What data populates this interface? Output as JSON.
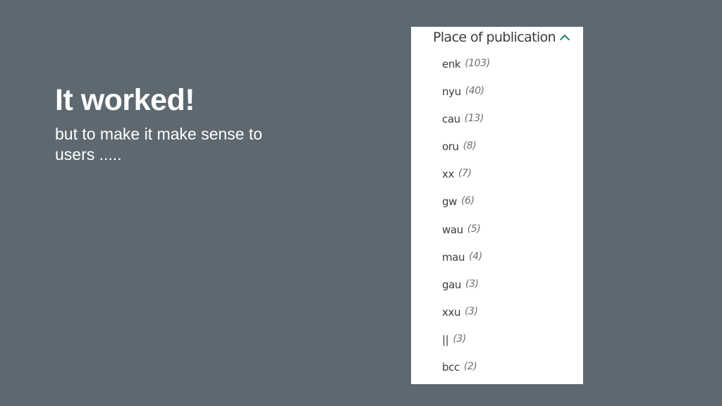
{
  "slide": {
    "title": "It worked!",
    "subtitle": "but to make it make sense to users ....."
  },
  "facet": {
    "header": "Place of publication",
    "icon": "chevron-up-icon",
    "accent_color": "#1f7a74",
    "items": [
      {
        "label": "enk",
        "count": "(103)"
      },
      {
        "label": "nyu",
        "count": "(40)"
      },
      {
        "label": "cau",
        "count": "(13)"
      },
      {
        "label": "oru",
        "count": "(8)"
      },
      {
        "label": "xx",
        "count": "(7)"
      },
      {
        "label": "gw",
        "count": "(6)"
      },
      {
        "label": "wau",
        "count": "(5)"
      },
      {
        "label": "mau",
        "count": "(4)"
      },
      {
        "label": "gau",
        "count": "(3)"
      },
      {
        "label": "xxu",
        "count": "(3)"
      },
      {
        "label": "||",
        "count": "(3)"
      },
      {
        "label": "bcc",
        "count": "(2)"
      }
    ]
  }
}
